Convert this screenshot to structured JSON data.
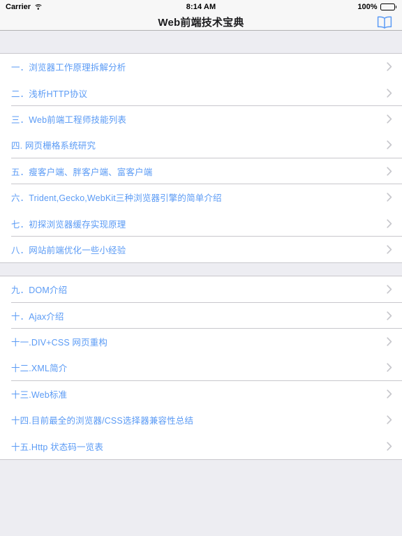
{
  "status_bar": {
    "carrier": "Carrier",
    "wifi_icon": "wifi-icon",
    "time": "8:14 AM",
    "battery_percent": "100%",
    "battery_icon": "battery-icon"
  },
  "nav_bar": {
    "title": "Web前端技术宝典",
    "right_icon": "book-icon"
  },
  "colors": {
    "accent_blue": "#5B9BF5",
    "background_gray": "#EDEDF2",
    "cell_white": "#FFFFFF",
    "separator": "#C8C7CC",
    "chevron": "#C7C7CC",
    "nav_background": "#F7F7F7",
    "title_text": "#1C1C1E"
  },
  "sections": [
    {
      "items": [
        {
          "label": "一．浏览器工作原理拆解分析",
          "accessory": "chevron-right-icon"
        },
        {
          "label": "二．浅析HTTP协议",
          "accessory": "chevron-right-icon"
        },
        {
          "label": "三．Web前端工程师技能列表",
          "accessory": "chevron-right-icon"
        },
        {
          "label": "四. 网页栅格系统研究",
          "accessory": "chevron-right-icon"
        },
        {
          "label": "五．瘦客户端、胖客户端、富客户端",
          "accessory": "chevron-right-icon"
        },
        {
          "label": "六．Trident,Gecko,WebKit三种浏览器引擎的简单介绍",
          "accessory": "chevron-right-icon"
        },
        {
          "label": "七．初探浏览器缓存实现原理",
          "accessory": "chevron-right-icon"
        },
        {
          "label": "八．网站前端优化一些小经验",
          "accessory": "chevron-right-icon"
        }
      ]
    },
    {
      "items": [
        {
          "label": "九．DOM介绍",
          "accessory": "chevron-right-icon"
        },
        {
          "label": "十．Ajax介绍",
          "accessory": "chevron-right-icon"
        },
        {
          "label": "十一.DIV+CSS 网页重构",
          "accessory": "chevron-right-icon"
        },
        {
          "label": "十二.XML简介",
          "accessory": "chevron-right-icon"
        },
        {
          "label": "十三.Web标准",
          "accessory": "chevron-right-icon"
        },
        {
          "label": "十四.目前最全的浏览器/CSS选择器兼容性总结",
          "accessory": "chevron-right-icon"
        },
        {
          "label": "十五.Http 状态码一览表",
          "accessory": "chevron-right-icon"
        }
      ]
    }
  ]
}
